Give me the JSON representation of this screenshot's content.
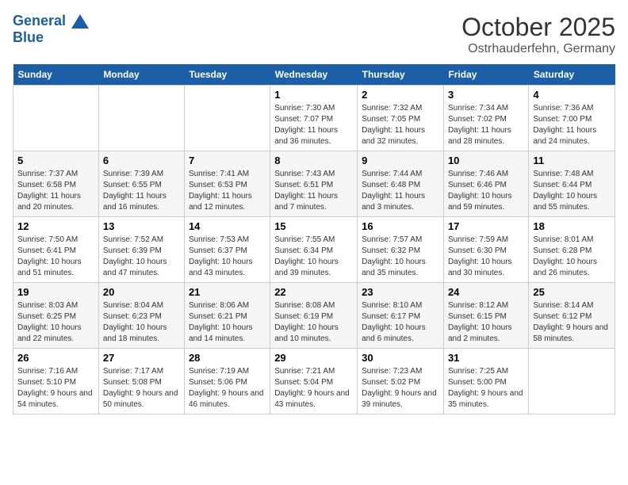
{
  "header": {
    "logo_line1": "General",
    "logo_line2": "Blue",
    "month": "October 2025",
    "location": "Ostrhauderfehn, Germany"
  },
  "days_of_week": [
    "Sunday",
    "Monday",
    "Tuesday",
    "Wednesday",
    "Thursday",
    "Friday",
    "Saturday"
  ],
  "weeks": [
    [
      {
        "day": "",
        "sunrise": "",
        "sunset": "",
        "daylight": ""
      },
      {
        "day": "",
        "sunrise": "",
        "sunset": "",
        "daylight": ""
      },
      {
        "day": "",
        "sunrise": "",
        "sunset": "",
        "daylight": ""
      },
      {
        "day": "1",
        "sunrise": "Sunrise: 7:30 AM",
        "sunset": "Sunset: 7:07 PM",
        "daylight": "Daylight: 11 hours and 36 minutes."
      },
      {
        "day": "2",
        "sunrise": "Sunrise: 7:32 AM",
        "sunset": "Sunset: 7:05 PM",
        "daylight": "Daylight: 11 hours and 32 minutes."
      },
      {
        "day": "3",
        "sunrise": "Sunrise: 7:34 AM",
        "sunset": "Sunset: 7:02 PM",
        "daylight": "Daylight: 11 hours and 28 minutes."
      },
      {
        "day": "4",
        "sunrise": "Sunrise: 7:36 AM",
        "sunset": "Sunset: 7:00 PM",
        "daylight": "Daylight: 11 hours and 24 minutes."
      }
    ],
    [
      {
        "day": "5",
        "sunrise": "Sunrise: 7:37 AM",
        "sunset": "Sunset: 6:58 PM",
        "daylight": "Daylight: 11 hours and 20 minutes."
      },
      {
        "day": "6",
        "sunrise": "Sunrise: 7:39 AM",
        "sunset": "Sunset: 6:55 PM",
        "daylight": "Daylight: 11 hours and 16 minutes."
      },
      {
        "day": "7",
        "sunrise": "Sunrise: 7:41 AM",
        "sunset": "Sunset: 6:53 PM",
        "daylight": "Daylight: 11 hours and 12 minutes."
      },
      {
        "day": "8",
        "sunrise": "Sunrise: 7:43 AM",
        "sunset": "Sunset: 6:51 PM",
        "daylight": "Daylight: 11 hours and 7 minutes."
      },
      {
        "day": "9",
        "sunrise": "Sunrise: 7:44 AM",
        "sunset": "Sunset: 6:48 PM",
        "daylight": "Daylight: 11 hours and 3 minutes."
      },
      {
        "day": "10",
        "sunrise": "Sunrise: 7:46 AM",
        "sunset": "Sunset: 6:46 PM",
        "daylight": "Daylight: 10 hours and 59 minutes."
      },
      {
        "day": "11",
        "sunrise": "Sunrise: 7:48 AM",
        "sunset": "Sunset: 6:44 PM",
        "daylight": "Daylight: 10 hours and 55 minutes."
      }
    ],
    [
      {
        "day": "12",
        "sunrise": "Sunrise: 7:50 AM",
        "sunset": "Sunset: 6:41 PM",
        "daylight": "Daylight: 10 hours and 51 minutes."
      },
      {
        "day": "13",
        "sunrise": "Sunrise: 7:52 AM",
        "sunset": "Sunset: 6:39 PM",
        "daylight": "Daylight: 10 hours and 47 minutes."
      },
      {
        "day": "14",
        "sunrise": "Sunrise: 7:53 AM",
        "sunset": "Sunset: 6:37 PM",
        "daylight": "Daylight: 10 hours and 43 minutes."
      },
      {
        "day": "15",
        "sunrise": "Sunrise: 7:55 AM",
        "sunset": "Sunset: 6:34 PM",
        "daylight": "Daylight: 10 hours and 39 minutes."
      },
      {
        "day": "16",
        "sunrise": "Sunrise: 7:57 AM",
        "sunset": "Sunset: 6:32 PM",
        "daylight": "Daylight: 10 hours and 35 minutes."
      },
      {
        "day": "17",
        "sunrise": "Sunrise: 7:59 AM",
        "sunset": "Sunset: 6:30 PM",
        "daylight": "Daylight: 10 hours and 30 minutes."
      },
      {
        "day": "18",
        "sunrise": "Sunrise: 8:01 AM",
        "sunset": "Sunset: 6:28 PM",
        "daylight": "Daylight: 10 hours and 26 minutes."
      }
    ],
    [
      {
        "day": "19",
        "sunrise": "Sunrise: 8:03 AM",
        "sunset": "Sunset: 6:25 PM",
        "daylight": "Daylight: 10 hours and 22 minutes."
      },
      {
        "day": "20",
        "sunrise": "Sunrise: 8:04 AM",
        "sunset": "Sunset: 6:23 PM",
        "daylight": "Daylight: 10 hours and 18 minutes."
      },
      {
        "day": "21",
        "sunrise": "Sunrise: 8:06 AM",
        "sunset": "Sunset: 6:21 PM",
        "daylight": "Daylight: 10 hours and 14 minutes."
      },
      {
        "day": "22",
        "sunrise": "Sunrise: 8:08 AM",
        "sunset": "Sunset: 6:19 PM",
        "daylight": "Daylight: 10 hours and 10 minutes."
      },
      {
        "day": "23",
        "sunrise": "Sunrise: 8:10 AM",
        "sunset": "Sunset: 6:17 PM",
        "daylight": "Daylight: 10 hours and 6 minutes."
      },
      {
        "day": "24",
        "sunrise": "Sunrise: 8:12 AM",
        "sunset": "Sunset: 6:15 PM",
        "daylight": "Daylight: 10 hours and 2 minutes."
      },
      {
        "day": "25",
        "sunrise": "Sunrise: 8:14 AM",
        "sunset": "Sunset: 6:12 PM",
        "daylight": "Daylight: 9 hours and 58 minutes."
      }
    ],
    [
      {
        "day": "26",
        "sunrise": "Sunrise: 7:16 AM",
        "sunset": "Sunset: 5:10 PM",
        "daylight": "Daylight: 9 hours and 54 minutes."
      },
      {
        "day": "27",
        "sunrise": "Sunrise: 7:17 AM",
        "sunset": "Sunset: 5:08 PM",
        "daylight": "Daylight: 9 hours and 50 minutes."
      },
      {
        "day": "28",
        "sunrise": "Sunrise: 7:19 AM",
        "sunset": "Sunset: 5:06 PM",
        "daylight": "Daylight: 9 hours and 46 minutes."
      },
      {
        "day": "29",
        "sunrise": "Sunrise: 7:21 AM",
        "sunset": "Sunset: 5:04 PM",
        "daylight": "Daylight: 9 hours and 43 minutes."
      },
      {
        "day": "30",
        "sunrise": "Sunrise: 7:23 AM",
        "sunset": "Sunset: 5:02 PM",
        "daylight": "Daylight: 9 hours and 39 minutes."
      },
      {
        "day": "31",
        "sunrise": "Sunrise: 7:25 AM",
        "sunset": "Sunset: 5:00 PM",
        "daylight": "Daylight: 9 hours and 35 minutes."
      },
      {
        "day": "",
        "sunrise": "",
        "sunset": "",
        "daylight": ""
      }
    ]
  ]
}
